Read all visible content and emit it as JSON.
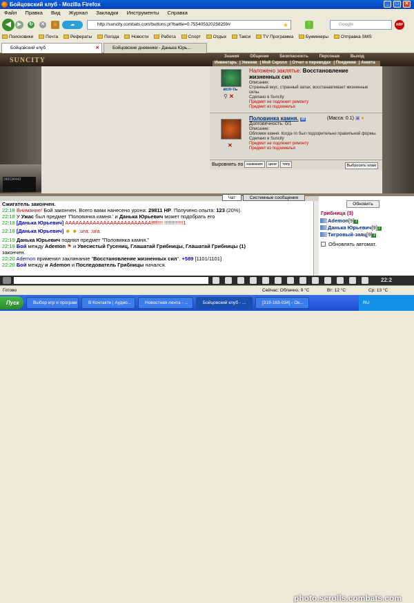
{
  "window": {
    "title": "Бойцовский клуб - Mozilla Firefox"
  },
  "menu": [
    "Файл",
    "Правка",
    "Вид",
    "Журнал",
    "Закладки",
    "Инструменты",
    "Справка"
  ],
  "nav": {
    "url": "http://suncity.combats.com/buttons.pl?battle=0.755405320258259#",
    "search_placeholder": "Google"
  },
  "bookmarks": [
    "Поисковики",
    "Почта",
    "Рефераты",
    "Погода",
    "Новости",
    "Работа",
    "Спорт",
    "Отдых",
    "Такси",
    "TV Программа",
    "Букмекеры",
    "Отправка SMS"
  ],
  "tabs": [
    {
      "label": "Бойцовский клуб"
    },
    {
      "label": "Бойцовские дневники - Данька Юрь..."
    }
  ],
  "game": {
    "logo": "SUNCITY",
    "topnav": [
      "Знания",
      "Общение",
      "Безопасность",
      "Персонаж",
      "Выход"
    ],
    "subnav": [
      "Инвентарь",
      "Умения",
      "Мой Скролл",
      "Отчет о переводах",
      "Поединки",
      "Анкета"
    ],
    "counter": "349194443"
  },
  "items": [
    {
      "name_prefix": "Наложено заклятье: ",
      "name": "Восстановление жизненных сил",
      "icon_label": "исп-ть",
      "desc": [
        "Описание:",
        "Странный вкус, странный запах, восстанавливает жизненные силы.",
        "Сделано в Suncity"
      ],
      "notes": [
        "Предмет не подлежит ремонту",
        "Предмет из подземелья"
      ]
    },
    {
      "name": "Половинка камня.",
      "badge": "VF",
      "mass": "(Масса: 0.1)",
      "durability": "Долговечность: 0/1",
      "desc": [
        "Описание:",
        "Обломок камня. Когда-то был подозрительно правильной формы.",
        "Сделано в Suncity"
      ],
      "notes": [
        "Предмет не подлежит ремонту",
        "Предмет из подземелья"
      ]
    }
  ],
  "sort": {
    "label": "Выровнять по",
    "buttons": [
      "название",
      "цене",
      "типу"
    ],
    "discard": "Выбросить хлам"
  },
  "chat_tabs": [
    "Чат",
    "Системные сообщения"
  ],
  "chat": [
    {
      "text": "Сжигатель закончен."
    },
    {
      "time": "22:18",
      "parts": [
        "Внимание!",
        " Бой закончен. Всего вами нанесено урона: ",
        "29811 HP",
        ". Получено опыта: ",
        "123",
        " (20%)."
      ]
    },
    {
      "time": "22:18",
      "parts": [
        "У ",
        "Ужас",
        " был предмет 'Половинка камня.' и ",
        "Данька Юрьевич",
        " может подобрать его"
      ]
    },
    {
      "time": "22:18",
      "parts": [
        "[Данька Юрьевич]",
        " ААААААААААААААААААААААААА!!!!!!!! !!!!!!!!!!!!!1"
      ]
    },
    {
      "time": "22:19",
      "parts": [
        "[Данька Юрьевич]",
        "  :ura:  :ura:"
      ]
    },
    {
      "time": "22:19",
      "parts": [
        "Данька Юрьевич",
        " поднял предмет \"Половинка камня.\""
      ]
    },
    {
      "time": "22:19",
      "parts": [
        "Бой",
        " между ",
        "Ademon",
        " и ",
        "Увесистый Гусениц, Глашатай Грибницы, Глашатай Грибницы (1)"
      ]
    },
    {
      "text": "закончен."
    },
    {
      "time": "22:20",
      "parts": [
        "Ademon",
        " применил заклинание \"",
        "Восстановление жизненных сил",
        "\". ",
        "+589",
        " [1101/1101]"
      ]
    },
    {
      "time": "22:20",
      "parts": [
        "Бой",
        " между ",
        "и Ademon",
        " и ",
        "Последователь Грибницы",
        " начался."
      ]
    }
  ],
  "side": {
    "refresh": "Обновить",
    "group": "Грибница (3)",
    "members": [
      {
        "name": "Ademon",
        "level": "[9]"
      },
      {
        "name": "Данька Юрьевич",
        "level": "[9]"
      },
      {
        "name": "Тигровый-заяц",
        "level": "[9]"
      }
    ],
    "auto": "Обновлять автомат."
  },
  "clock": "22:2",
  "status": {
    "left": "Готово",
    "weather": "Сейчас: Облачно, 9 °C",
    "tue": "Вт: 12 °C",
    "wed": "Ср: 13 °C"
  },
  "taskbar": {
    "start": "Пуск",
    "tasks": [
      "Выбор игр и програм",
      "В Контакте | Аудио...",
      "Новостная лента - ...",
      "Бойцовский клуб - ...",
      "[319-163-034] - Ок..."
    ],
    "tray": "RU"
  },
  "watermark": "photo.scrolls.combats.com"
}
